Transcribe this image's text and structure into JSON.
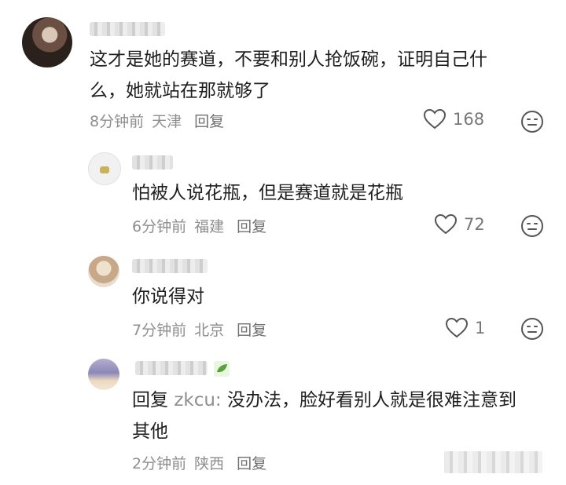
{
  "comments": [
    {
      "text_lines": [
        "这才是她的赛道，不要和别人抢饭碗，证明自己什",
        "么，她就站在那就够了"
      ],
      "time": "8分钟前",
      "location": "天津",
      "reply_label": "回复",
      "likes": "168"
    },
    {
      "text_lines": [
        "怕被人说花瓶，但是赛道就是花瓶"
      ],
      "time": "6分钟前",
      "location": "福建",
      "reply_label": "回复",
      "likes": "72"
    },
    {
      "text_lines": [
        "你说得对"
      ],
      "time": "7分钟前",
      "location": "北京",
      "reply_label": "回复",
      "likes": "1"
    },
    {
      "reply_prefix": "回复",
      "mention": "zkcu:",
      "text_lines": [
        "没办法，脸好看别人就是很难注意到",
        "其他"
      ],
      "time": "2分钟前",
      "location": "陕西",
      "reply_label": "回复"
    }
  ],
  "icons": {
    "like": "heart-outline-icon",
    "emoji": "neutral-face-icon"
  },
  "colors": {
    "text": "#1f1f1f",
    "meta": "#8e8e8e",
    "icon": "#555555"
  }
}
